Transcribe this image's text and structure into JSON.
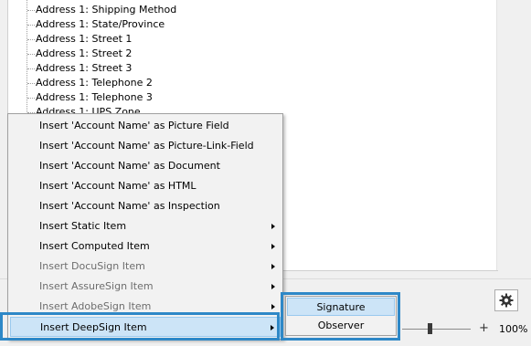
{
  "tree": {
    "items": [
      "Address 1: Shipping Method",
      "Address 1: State/Province",
      "Address 1: Street 1",
      "Address 1: Street 2",
      "Address 1: Street 3",
      "Address 1: Telephone 2",
      "Address 1: Telephone 3",
      "Address 1: UPS Zone"
    ]
  },
  "context_menu": {
    "items": [
      {
        "label": "Insert 'Account Name' as Picture Field",
        "disabled": false,
        "submenu": false
      },
      {
        "label": "Insert 'Account Name' as Picture-Link-Field",
        "disabled": false,
        "submenu": false
      },
      {
        "label": "Insert 'Account Name' as Document",
        "disabled": false,
        "submenu": false
      },
      {
        "label": "Insert 'Account Name' as HTML",
        "disabled": false,
        "submenu": false
      },
      {
        "label": "Insert 'Account Name' as Inspection",
        "disabled": false,
        "submenu": false
      },
      {
        "label": "Insert Static Item",
        "disabled": false,
        "submenu": true
      },
      {
        "label": "Insert Computed Item",
        "disabled": false,
        "submenu": true
      },
      {
        "label": "Insert DocuSign Item",
        "disabled": true,
        "submenu": true
      },
      {
        "label": "Insert AssureSign Item",
        "disabled": true,
        "submenu": true
      },
      {
        "label": "Insert AdobeSign Item",
        "disabled": true,
        "submenu": true
      },
      {
        "label": "Insert DeepSign Item",
        "disabled": false,
        "submenu": true,
        "active": true
      }
    ]
  },
  "submenu": {
    "items": [
      {
        "label": "Signature",
        "active": true
      },
      {
        "label": "Observer",
        "active": false
      }
    ]
  },
  "zoom": {
    "plus": "+",
    "level_text": "100%",
    "level": 1.0
  },
  "toolbar": {
    "settings_icon": "gear-icon"
  },
  "colors": {
    "highlight_frame": "#2e88c7",
    "menu_hover": "#cce4f7",
    "menu_hover_border": "#99c9ef",
    "disabled_text": "#6d6d6d"
  }
}
